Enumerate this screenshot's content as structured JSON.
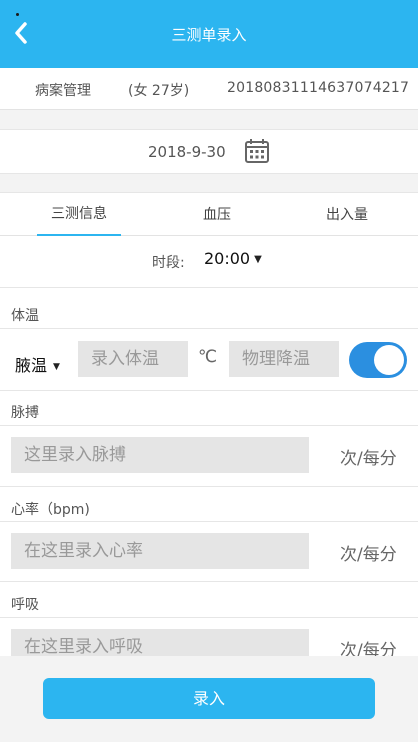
{
  "header": {
    "title": "三测单录入"
  },
  "patient": {
    "name": "病案管理",
    "info": "(女 27岁)",
    "id": "20180831114637074217"
  },
  "date": {
    "value": "2018-9-30"
  },
  "tabs": [
    {
      "label": "三测信息",
      "active": true
    },
    {
      "label": "血压",
      "active": false
    },
    {
      "label": "出入量",
      "active": false
    }
  ],
  "period": {
    "label": "时段:",
    "value": "20:00"
  },
  "temperature": {
    "label": "体温",
    "mode": "腋温",
    "placeholder": "录入体温",
    "unit": "℃",
    "physical_cooling_placeholder": "物理降温",
    "toggle_on": true
  },
  "pulse": {
    "label": "脉搏",
    "placeholder": "这里录入脉搏",
    "unit": "次/每分"
  },
  "heart_rate": {
    "label": "心率（bpm)",
    "placeholder": "在这里录入心率",
    "unit": "次/每分"
  },
  "respiration": {
    "label": "呼吸",
    "placeholder": "在这里录入呼吸",
    "unit": "次/每分"
  },
  "footer": {
    "submit_label": "录入"
  },
  "colors": {
    "accent": "#2cb5f0",
    "toggle": "#2b8fe0"
  },
  "icons": {
    "back": "chevron-left-icon",
    "calendar": "calendar-icon",
    "caret": "caret-down-icon"
  }
}
